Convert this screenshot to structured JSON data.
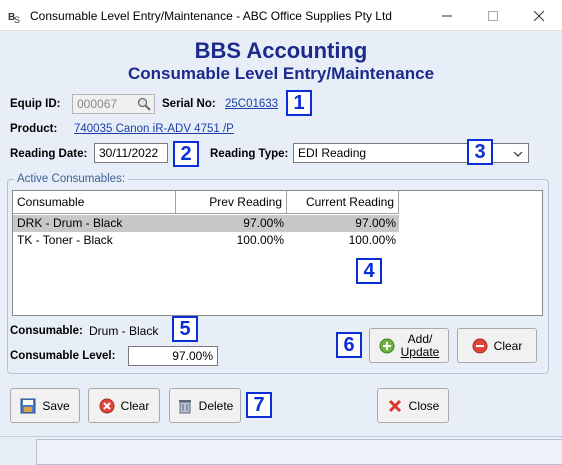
{
  "window": {
    "title": "Consumable Level Entry/Maintenance - ABC Office Supplies Pty Ltd"
  },
  "header": {
    "title": "BBS Accounting",
    "subtitle": "Consumable Level Entry/Maintenance"
  },
  "form": {
    "equip_id_label": "Equip ID:",
    "equip_id_value": "000067",
    "serial_label": "Serial No:",
    "serial_value": "25C01633",
    "product_label": "Product:",
    "product_value": "740035 Canon iR-ADV 4751 /P",
    "reading_date_label": "Reading Date:",
    "reading_date_value": "30/11/2022",
    "reading_type_label": "Reading Type:",
    "reading_type_value": "EDI Reading"
  },
  "consumables": {
    "group_label": "Active Consumables:",
    "columns": [
      "Consumable",
      "Prev Reading",
      "Current Reading"
    ],
    "rows": [
      {
        "consumable": "DRK - Drum - Black",
        "prev": "97.00%",
        "current": "97.00%"
      },
      {
        "consumable": "TK - Toner - Black",
        "prev": "100.00%",
        "current": "100.00%"
      }
    ],
    "selected_label": "Consumable:",
    "selected_value": "Drum - Black",
    "level_label": "Consumable Level:",
    "level_value": "97.00%",
    "add_update_label_1": "Add/",
    "add_update_label_2": "Update",
    "clear_label": "Clear"
  },
  "toolbar": {
    "save_label": "Save",
    "clear_label": "Clear",
    "delete_label": "Delete",
    "close_label": "Close"
  },
  "callouts": [
    "1",
    "2",
    "3",
    "4",
    "5",
    "6",
    "7"
  ],
  "colors": {
    "title_blue": "#1c2a8c",
    "callout_blue": "#0b2fd6",
    "link_blue": "#1a3fa8",
    "background": "#e8eef7"
  }
}
